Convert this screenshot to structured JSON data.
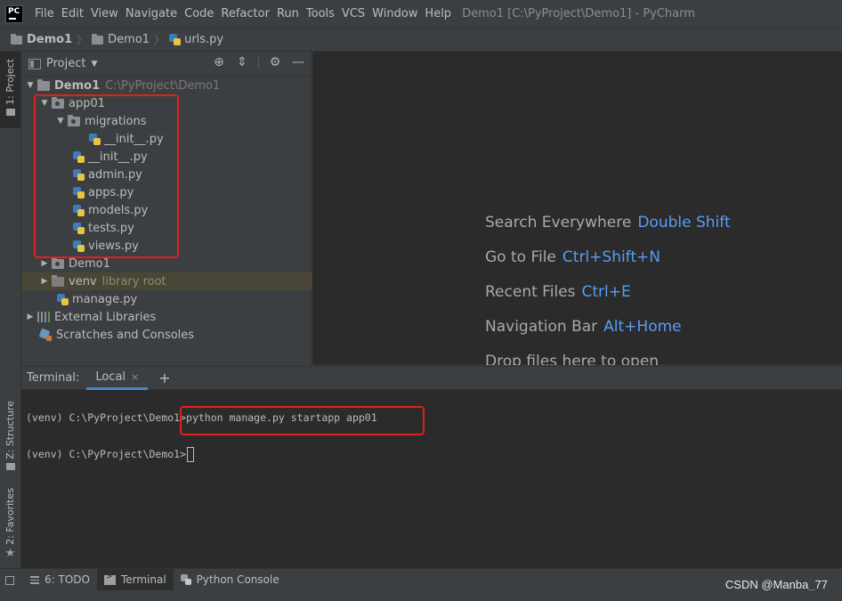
{
  "menubar": {
    "logo": "PC",
    "items": [
      "File",
      "Edit",
      "View",
      "Navigate",
      "Code",
      "Refactor",
      "Run",
      "Tools",
      "VCS",
      "Window",
      "Help"
    ],
    "title": "Demo1 [C:\\PyProject\\Demo1] - PyCharm"
  },
  "breadcrumb": [
    "Demo1",
    "Demo1",
    "urls.py"
  ],
  "left_strip": {
    "project": "1: Project",
    "structure": "Z: Structure",
    "favorites": "2: Favorites"
  },
  "project_panel": {
    "header": "Project",
    "tree": [
      {
        "label": "Demo1",
        "hint": "C:\\PyProject\\Demo1"
      },
      {
        "label": "app01"
      },
      {
        "label": "migrations"
      },
      {
        "label": "__init__.py"
      },
      {
        "label": "__init__.py"
      },
      {
        "label": "admin.py"
      },
      {
        "label": "apps.py"
      },
      {
        "label": "models.py"
      },
      {
        "label": "tests.py"
      },
      {
        "label": "views.py"
      },
      {
        "label": "Demo1"
      },
      {
        "label": "venv",
        "hint": "library root"
      },
      {
        "label": "manage.py"
      },
      {
        "label": "External Libraries"
      },
      {
        "label": "Scratches and Consoles"
      }
    ]
  },
  "editor": {
    "hints": [
      {
        "text": "Search Everywhere",
        "key": "Double Shift"
      },
      {
        "text": "Go to File",
        "key": "Ctrl+Shift+N"
      },
      {
        "text": "Recent Files",
        "key": "Ctrl+E"
      },
      {
        "text": "Navigation Bar",
        "key": "Alt+Home"
      },
      {
        "text": "Drop files here to open",
        "key": ""
      }
    ]
  },
  "terminal": {
    "label": "Terminal:",
    "tab": "Local",
    "tab_close": "×",
    "add": "+",
    "lines": [
      {
        "prompt": "(venv) C:\\PyProject\\Demo1>",
        "command": "python manage.py startapp app01"
      },
      {
        "prompt": "(venv) C:\\PyProject\\Demo1>",
        "command": ""
      }
    ]
  },
  "statusbar": {
    "tabs": [
      {
        "label": "6: TODO"
      },
      {
        "label": "Terminal"
      },
      {
        "label": "Python Console"
      }
    ]
  },
  "watermark": "CSDN @Manba_77",
  "colors": {
    "accent": "#589df6",
    "annotation_red": "#e0201b",
    "editor_bg": "#2b2b2b",
    "panel_bg": "#3c3f41"
  }
}
